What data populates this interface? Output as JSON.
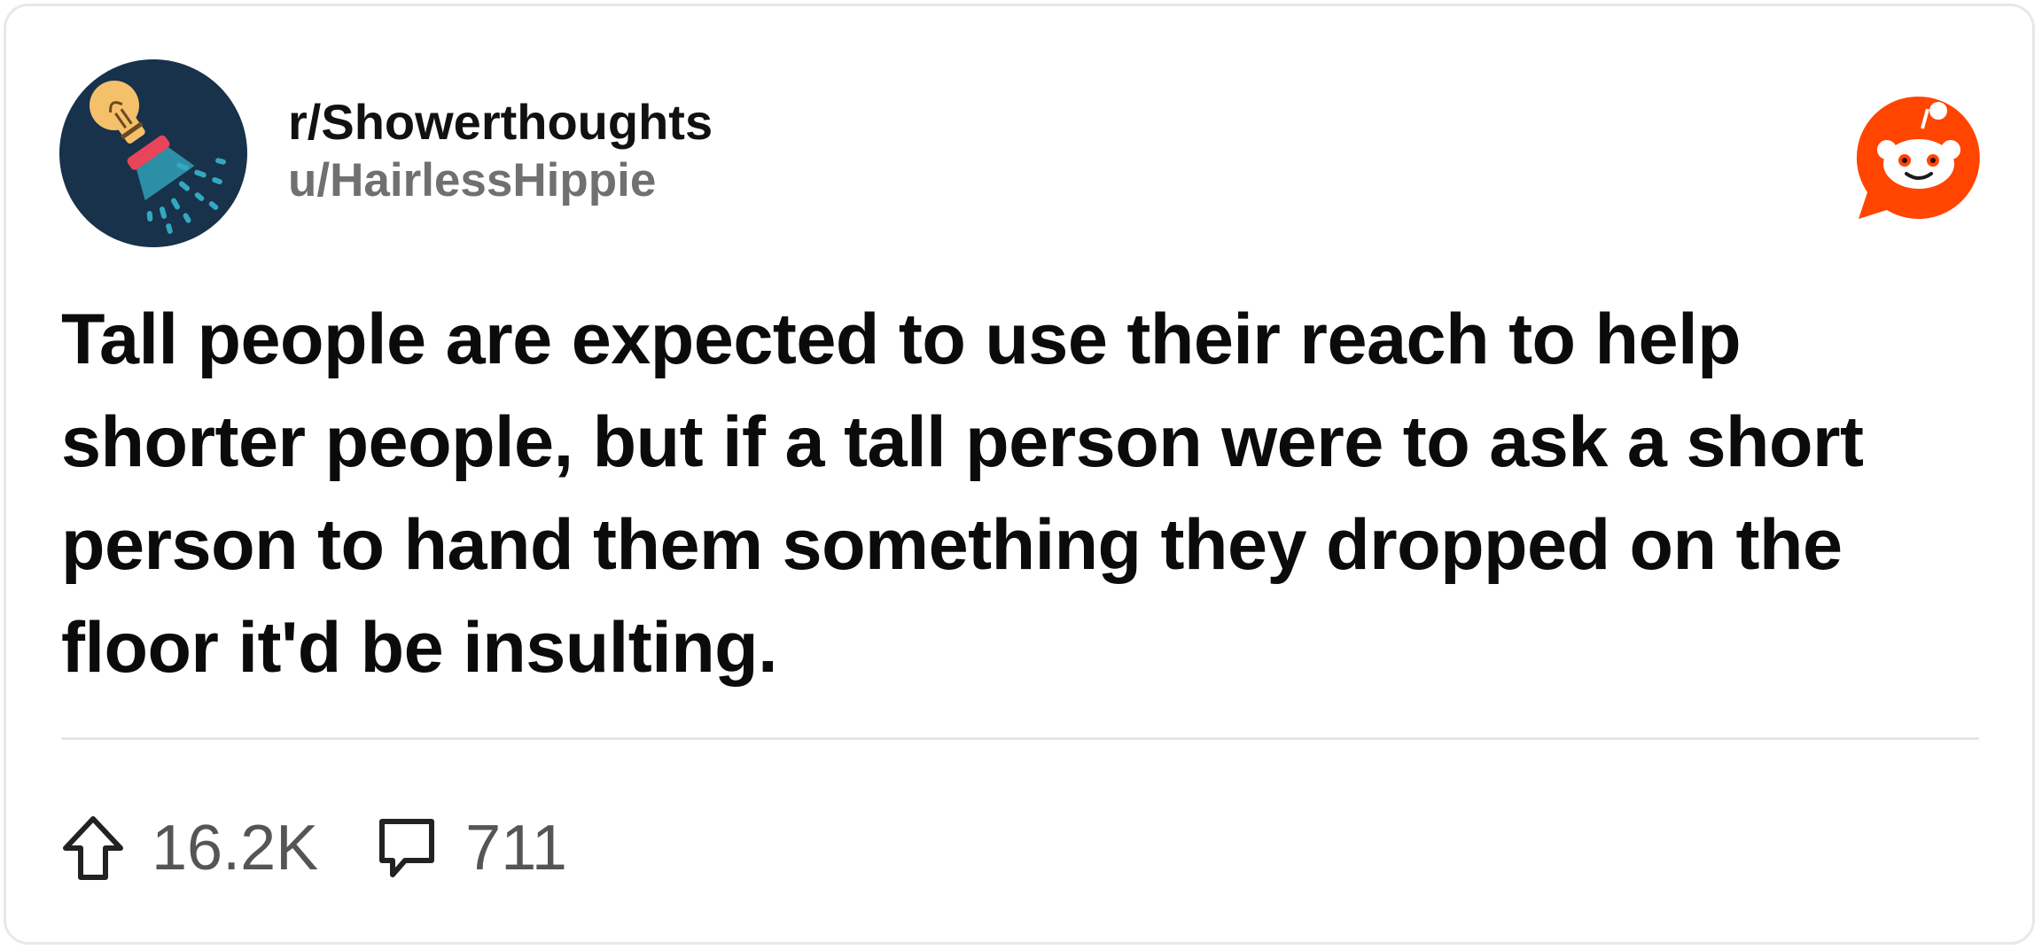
{
  "header": {
    "subreddit": "r/Showerthoughts",
    "username": "u/HairlessHippie",
    "avatar_icon": "lightbulb-shower-icon",
    "brand_icon": "reddit-snoo-icon"
  },
  "post": {
    "title": "Tall people are expected to use their reach to help shorter people, but if a tall person were to ask a short person to hand them something they dropped on the floor it'd be insulting."
  },
  "stats": {
    "upvotes": "16.2K",
    "upvote_icon": "upvote-arrow-icon",
    "comments": "711",
    "comment_icon": "comment-bubble-icon"
  },
  "colors": {
    "avatar_bg": "#17324a",
    "bulb": "#f5c06a",
    "shower_red": "#e9455a",
    "water": "#33a8c0",
    "reddit_orange": "#ff4500",
    "text_primary": "#0b0b0b",
    "text_secondary": "#707070"
  }
}
